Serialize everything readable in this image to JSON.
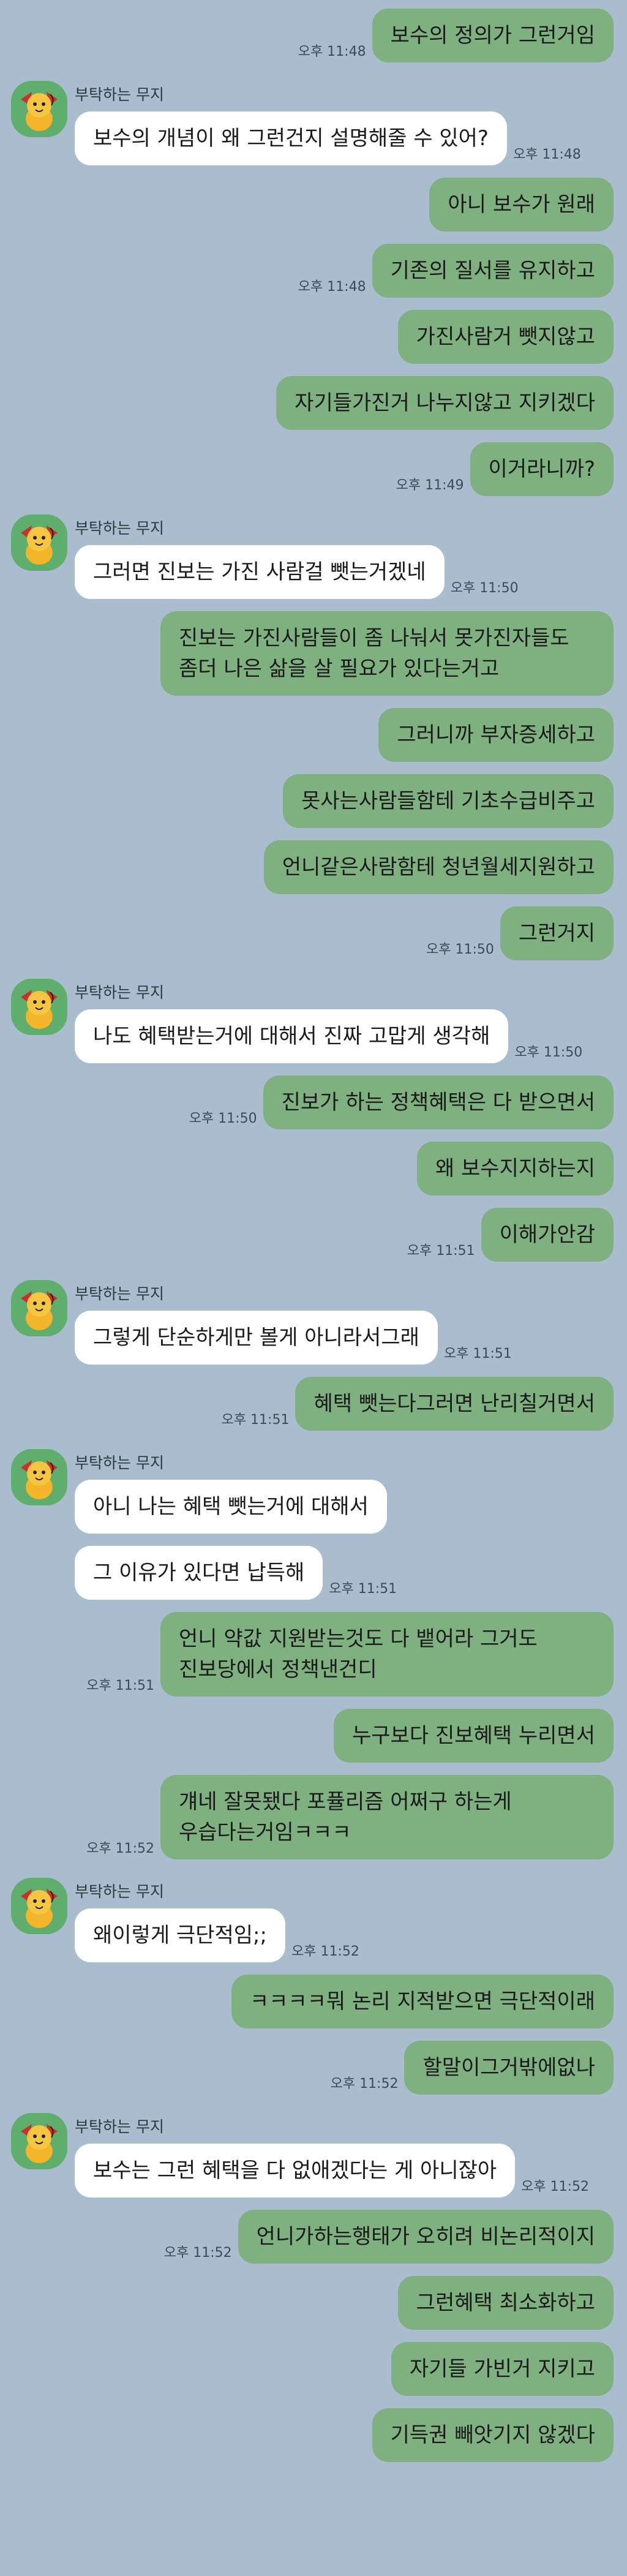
{
  "sender_name": "부탁하는 무지",
  "messages": [
    {
      "who": "me",
      "text": "보수의 정의가 그런거임",
      "time": "오후 11:48"
    },
    {
      "who": "other",
      "first": true,
      "text": "보수의 개념이 왜 그런건지 설명해줄 수 있어?",
      "time": "오후 11:48"
    },
    {
      "who": "me",
      "text": "아니 보수가 원래",
      "time": ""
    },
    {
      "who": "me",
      "text": "기존의 질서를 유지하고",
      "time": "오후 11:48"
    },
    {
      "who": "me",
      "text": "가진사람거 뺏지않고",
      "time": ""
    },
    {
      "who": "me",
      "text": "자기들가진거 나누지않고 지키겠다",
      "time": ""
    },
    {
      "who": "me",
      "text": "이거라니까?",
      "time": "오후 11:49"
    },
    {
      "who": "other",
      "first": true,
      "text": "그러면 진보는 가진 사람걸 뺏는거겠네",
      "time": "오후 11:50"
    },
    {
      "who": "me",
      "text": "진보는 가진사람들이 좀 나눠서 못가진자들도 좀더 나은 삶을 살 필요가 있다는거고",
      "time": ""
    },
    {
      "who": "me",
      "text": "그러니까 부자증세하고",
      "time": ""
    },
    {
      "who": "me",
      "text": "못사는사람들함테 기초수급비주고",
      "time": ""
    },
    {
      "who": "me",
      "text": "언니같은사람함테 청년월세지원하고",
      "time": ""
    },
    {
      "who": "me",
      "text": "그런거지",
      "time": "오후 11:50"
    },
    {
      "who": "other",
      "first": true,
      "text": "나도 혜택받는거에 대해서 진짜 고맙게 생각해",
      "time": "오후 11:50"
    },
    {
      "who": "me",
      "text": "진보가 하는 정책혜택은 다 받으면서",
      "time": "오후 11:50"
    },
    {
      "who": "me",
      "text": "왜 보수지지하는지",
      "time": ""
    },
    {
      "who": "me",
      "text": "이해가안감",
      "time": "오후 11:51"
    },
    {
      "who": "other",
      "first": true,
      "text": "그렇게 단순하게만 볼게 아니라서그래",
      "time": "오후 11:51"
    },
    {
      "who": "me",
      "text": "혜택 뺏는다그러면 난리칠거면서",
      "time": "오후 11:51"
    },
    {
      "who": "other",
      "first": true,
      "text": "아니 나는 혜택 뺏는거에 대해서",
      "time": ""
    },
    {
      "who": "other",
      "first": false,
      "text": "그 이유가 있다면 납득해",
      "time": "오후 11:51"
    },
    {
      "who": "me",
      "text": "언니 약값 지원받는것도 다 뱉어라 그거도 진보당에서 정책낸건디",
      "time": "오후 11:51"
    },
    {
      "who": "me",
      "text": "누구보다 진보혜택 누리면서",
      "time": ""
    },
    {
      "who": "me",
      "text": "걔네 잘못됐다 포퓰리즘 어쩌구 하는게 우습다는거임ㅋㅋㅋ",
      "time": "오후 11:52"
    },
    {
      "who": "other",
      "first": true,
      "text": "왜이렇게 극단적임;;",
      "time": "오후 11:52"
    },
    {
      "who": "me",
      "text": "ㅋㅋㅋㅋ뭐 논리 지적받으면 극단적이래",
      "time": ""
    },
    {
      "who": "me",
      "text": "할말이그거밖에없나",
      "time": "오후 11:52"
    },
    {
      "who": "other",
      "first": true,
      "text": "보수는 그런 혜택을 다 없애겠다는 게 아니잖아",
      "time": "오후 11:52"
    },
    {
      "who": "me",
      "text": "언니가하는행태가 오히려 비논리적이지",
      "time": "오후 11:52"
    },
    {
      "who": "me",
      "text": "그런혜택 최소화하고",
      "time": ""
    },
    {
      "who": "me",
      "text": "자기들 가빈거 지키고",
      "time": ""
    },
    {
      "who": "me",
      "text": "기득권 빼앗기지 않겠다",
      "time": ""
    }
  ]
}
